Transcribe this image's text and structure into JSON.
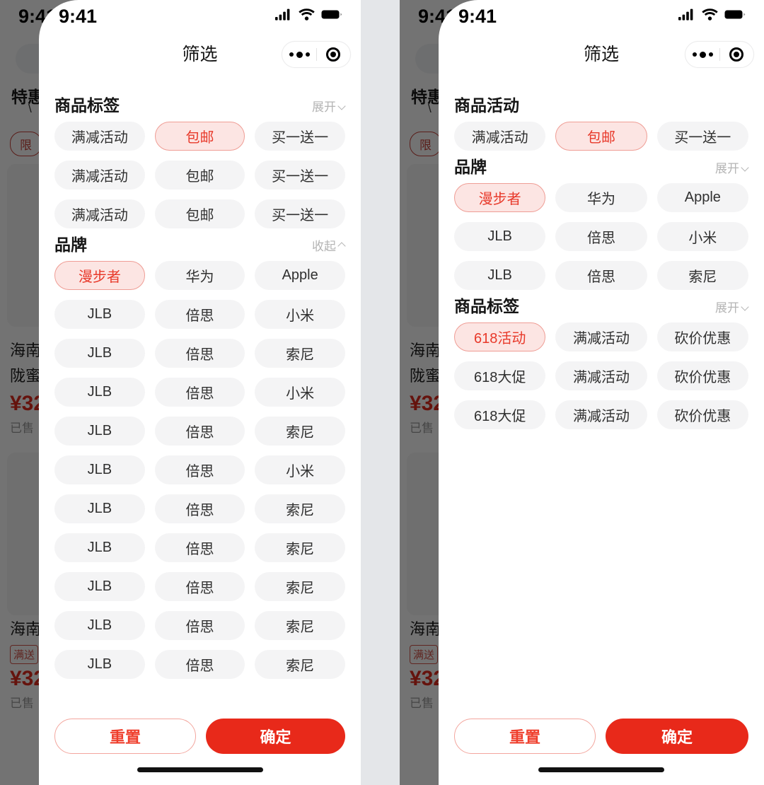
{
  "background": {
    "status_time": "9:41",
    "search_placeholder": "",
    "section_title": "特惠",
    "arrow_glyph": "\\",
    "promo_chip": "限",
    "product_left": {
      "line1": "海南",
      "line2": "陇蜜",
      "price": "¥32",
      "sold": "已售"
    },
    "product_left_lower": {
      "line1": "海南",
      "tag": "满送",
      "price": "¥32",
      "sold": "已售"
    }
  },
  "left_panel": {
    "status_time": "9:41",
    "nav_title": "筛选",
    "capsule": {
      "more_icon": "more-dots-icon",
      "target_icon": "target-circle-icon"
    },
    "groups": [
      {
        "title": "商品标签",
        "toggle_label": "展开",
        "toggle_state": "collapsed",
        "chips": [
          {
            "label": "满减活动",
            "selected": false
          },
          {
            "label": "包邮",
            "selected": true
          },
          {
            "label": "买一送一",
            "selected": false
          },
          {
            "label": "满减活动",
            "selected": false
          },
          {
            "label": "包邮",
            "selected": false
          },
          {
            "label": "买一送一",
            "selected": false
          },
          {
            "label": "满减活动",
            "selected": false
          },
          {
            "label": "包邮",
            "selected": false
          },
          {
            "label": "买一送一",
            "selected": false
          }
        ]
      },
      {
        "title": "品牌",
        "toggle_label": "收起",
        "toggle_state": "expanded",
        "chips": [
          {
            "label": "漫步者",
            "selected": true
          },
          {
            "label": "华为",
            "selected": false
          },
          {
            "label": "Apple",
            "selected": false
          },
          {
            "label": "JLB",
            "selected": false
          },
          {
            "label": "倍思",
            "selected": false
          },
          {
            "label": "小米",
            "selected": false
          },
          {
            "label": "JLB",
            "selected": false
          },
          {
            "label": "倍思",
            "selected": false
          },
          {
            "label": "索尼",
            "selected": false
          },
          {
            "label": "JLB",
            "selected": false
          },
          {
            "label": "倍思",
            "selected": false
          },
          {
            "label": "小米",
            "selected": false
          },
          {
            "label": "JLB",
            "selected": false
          },
          {
            "label": "倍思",
            "selected": false
          },
          {
            "label": "索尼",
            "selected": false
          },
          {
            "label": "JLB",
            "selected": false
          },
          {
            "label": "倍思",
            "selected": false
          },
          {
            "label": "小米",
            "selected": false
          },
          {
            "label": "JLB",
            "selected": false
          },
          {
            "label": "倍思",
            "selected": false
          },
          {
            "label": "索尼",
            "selected": false
          },
          {
            "label": "JLB",
            "selected": false
          },
          {
            "label": "倍思",
            "selected": false
          },
          {
            "label": "索尼",
            "selected": false
          },
          {
            "label": "JLB",
            "selected": false
          },
          {
            "label": "倍思",
            "selected": false
          },
          {
            "label": "索尼",
            "selected": false
          },
          {
            "label": "JLB",
            "selected": false
          },
          {
            "label": "倍思",
            "selected": false
          },
          {
            "label": "索尼",
            "selected": false
          },
          {
            "label": "JLB",
            "selected": false
          },
          {
            "label": "倍思",
            "selected": false
          },
          {
            "label": "索尼",
            "selected": false
          }
        ]
      }
    ],
    "footer": {
      "reset_label": "重置",
      "confirm_label": "确定"
    }
  },
  "right_panel": {
    "status_time": "9:41",
    "nav_title": "筛选",
    "capsule": {
      "more_icon": "more-dots-icon",
      "target_icon": "target-circle-icon"
    },
    "groups": [
      {
        "title": "商品活动",
        "toggle_label": "",
        "toggle_state": "none",
        "chips": [
          {
            "label": "满减活动",
            "selected": false
          },
          {
            "label": "包邮",
            "selected": true
          },
          {
            "label": "买一送一",
            "selected": false
          }
        ]
      },
      {
        "title": "品牌",
        "toggle_label": "展开",
        "toggle_state": "collapsed",
        "chips": [
          {
            "label": "漫步者",
            "selected": true
          },
          {
            "label": "华为",
            "selected": false
          },
          {
            "label": "Apple",
            "selected": false
          },
          {
            "label": "JLB",
            "selected": false
          },
          {
            "label": "倍思",
            "selected": false
          },
          {
            "label": "小米",
            "selected": false
          },
          {
            "label": "JLB",
            "selected": false
          },
          {
            "label": "倍思",
            "selected": false
          },
          {
            "label": "索尼",
            "selected": false
          }
        ]
      },
      {
        "title": "商品标签",
        "toggle_label": "展开",
        "toggle_state": "collapsed",
        "chips": [
          {
            "label": "618活动",
            "selected": true
          },
          {
            "label": "满减活动",
            "selected": false
          },
          {
            "label": "砍价优惠",
            "selected": false
          },
          {
            "label": "618大促",
            "selected": false
          },
          {
            "label": "满减活动",
            "selected": false
          },
          {
            "label": "砍价优惠",
            "selected": false
          },
          {
            "label": "618大促",
            "selected": false
          },
          {
            "label": "满减活动",
            "selected": false
          },
          {
            "label": "砍价优惠",
            "selected": false
          }
        ]
      }
    ],
    "footer": {
      "reset_label": "重置",
      "confirm_label": "确定"
    }
  },
  "colors": {
    "accent": "#e8291a",
    "chip_bg": "#f4f4f5",
    "chip_selected_bg": "#fce5e3",
    "chip_selected_border": "#ef9d95",
    "muted_text": "#b4b4b4",
    "gap": "#e4e6e9"
  }
}
